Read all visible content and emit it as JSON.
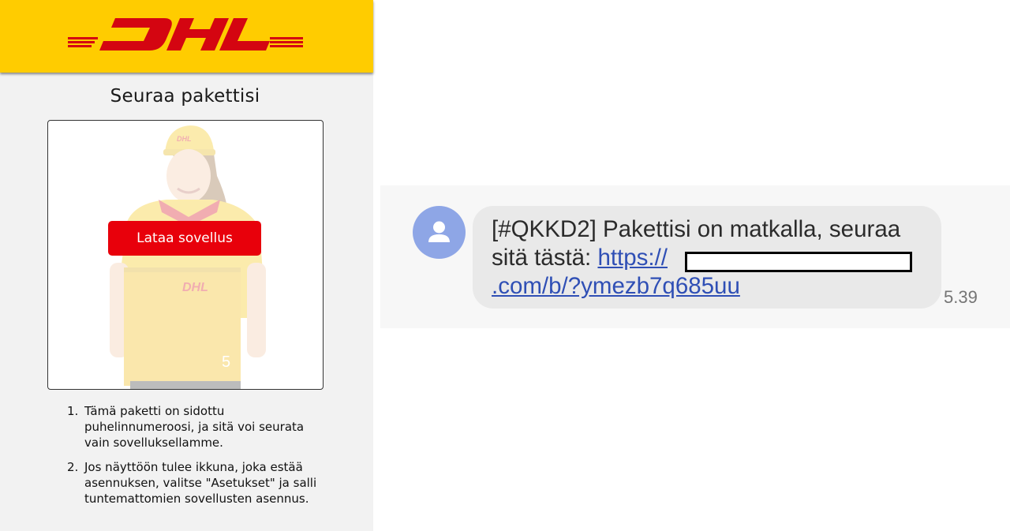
{
  "left_page": {
    "logo_text": "DHL",
    "title": "Seuraa pakettisi",
    "hero": {
      "button_label": "Lataa sovellus",
      "box_label": "DHL",
      "box_number": "5"
    },
    "instructions": [
      {
        "number": "1.",
        "text": "Tämä paketti on sidottu puhelinnumeroosi, ja sitä voi seurata vain sovelluksellamme."
      },
      {
        "number": "2.",
        "text": "Jos näyttöön tulee ikkuna, joka estää asennuksen, valitse \"Asetukset\" ja salli tuntemattomien sovellusten asennus."
      }
    ]
  },
  "sms": {
    "avatar_icon": "person-icon",
    "message_prefix": "[#QKKD2] Pakettisi on matkalla, seuraa sitä tästä: ",
    "link_start": "https://",
    "link_end": ".com/b/?ymezb7q685uu",
    "time": "5.39"
  },
  "colors": {
    "dhl_yellow": "#ffcc00",
    "dhl_red": "#d40511",
    "button_red": "#e8000b",
    "link_blue": "#2f4fb5",
    "avatar_blue": "#8ea6e6"
  }
}
